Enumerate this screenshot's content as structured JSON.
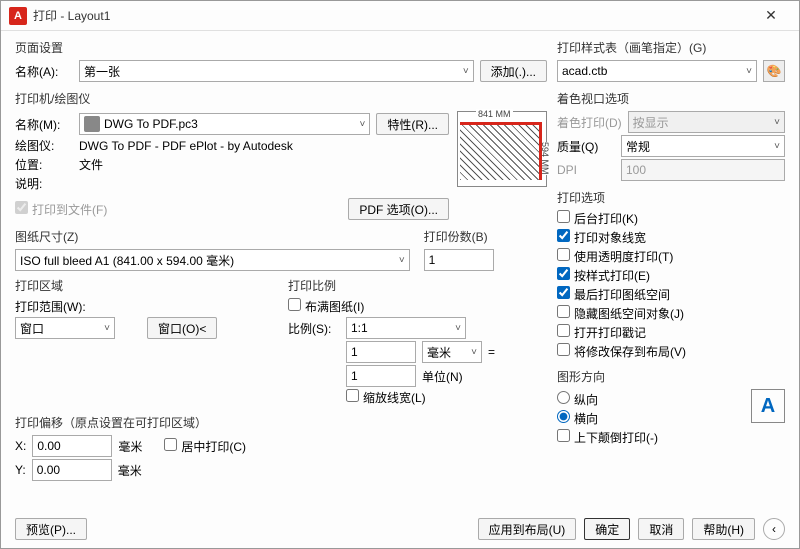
{
  "titlebar": {
    "title": "打印 - Layout1",
    "close": "✕"
  },
  "pageSetup": {
    "legend": "页面设置",
    "nameLabel": "名称(A):",
    "nameValue": "第一张",
    "addBtn": "添加(.)..."
  },
  "printer": {
    "legend": "打印机/绘图仪",
    "nameLabel": "名称(M):",
    "nameValue": "DWG To PDF.pc3",
    "propsBtn": "特性(R)...",
    "plotterLabel": "绘图仪:",
    "plotterValue": "DWG To PDF - PDF ePlot - by Autodesk",
    "locationLabel": "位置:",
    "locationValue": "文件",
    "descLabel": "说明:",
    "printToFile": "打印到文件(F)",
    "pdfOptionsBtn": "PDF 选项(O)...",
    "previewW": "841 MM",
    "previewH": "594 MM"
  },
  "paper": {
    "legend": "图纸尺寸(Z)",
    "value": "ISO full bleed A1 (841.00 x 594.00 毫米)"
  },
  "copies": {
    "legend": "打印份数(B)",
    "value": "1"
  },
  "area": {
    "legend": "打印区域",
    "rangeLabel": "打印范围(W):",
    "rangeValue": "窗口",
    "windowBtn": "窗口(O)<"
  },
  "scale": {
    "legend": "打印比例",
    "fitLabel": "布满图纸(I)",
    "scaleLabel": "比例(S):",
    "scaleValue": "1:1",
    "num1": "1",
    "unit1": "毫米",
    "equalsSuffix": "=",
    "num2": "1",
    "unit2": "单位(N)",
    "scaleLW": "缩放线宽(L)"
  },
  "offset": {
    "legend": "打印偏移（原点设置在可打印区域）",
    "xLabel": "X:",
    "xValue": "0.00",
    "xUnit": "毫米",
    "centerLabel": "居中打印(C)",
    "yLabel": "Y:",
    "yValue": "0.00",
    "yUnit": "毫米"
  },
  "styleTable": {
    "legend": "打印样式表（画笔指定）(G)",
    "value": "acad.ctb"
  },
  "viewport": {
    "legend": "着色视口选项",
    "shadeLabel": "着色打印(D)",
    "shadeValue": "按显示",
    "qualityLabel": "质量(Q)",
    "qualityValue": "常规",
    "dpiLabel": "DPI",
    "dpiValue": "100"
  },
  "options": {
    "legend": "打印选项",
    "bg": "后台打印(K)",
    "lw": "打印对象线宽",
    "trans": "使用透明度打印(T)",
    "byStyle": "按样式打印(E)",
    "paperLast": "最后打印图纸空间",
    "hidePaper": "隐藏图纸空间对象(J)",
    "stamp": "打开打印戳记",
    "saveLayout": "将修改保存到布局(V)"
  },
  "orientation": {
    "legend": "图形方向",
    "portrait": "纵向",
    "landscape": "横向",
    "upside": "上下颠倒打印(-)"
  },
  "footer": {
    "preview": "预览(P)...",
    "apply": "应用到布局(U)",
    "ok": "确定",
    "cancel": "取消",
    "help": "帮助(H)",
    "collapse": "‹"
  }
}
